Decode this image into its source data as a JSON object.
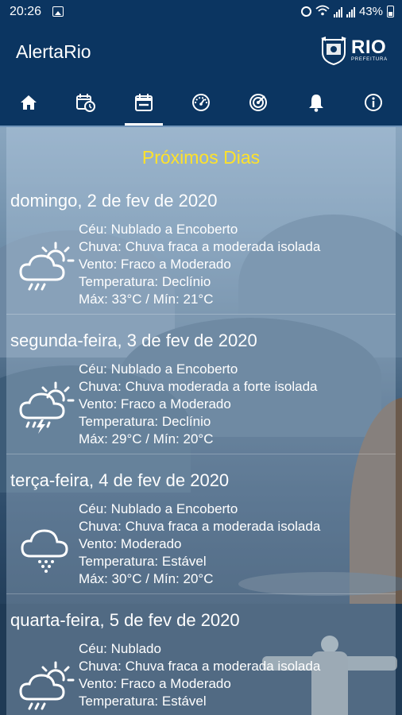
{
  "status_bar": {
    "time": "20:26",
    "battery": "43%"
  },
  "app_bar": {
    "title": "AlertaRio",
    "logo_text": "RIO",
    "logo_sub": "PREFEITURA"
  },
  "tabs": [
    {
      "name": "home-icon",
      "active": false
    },
    {
      "name": "calendar-clock-icon",
      "active": false
    },
    {
      "name": "calendar-icon",
      "active": true
    },
    {
      "name": "gauge-icon",
      "active": false
    },
    {
      "name": "radar-icon",
      "active": false
    },
    {
      "name": "bell-icon",
      "active": false
    },
    {
      "name": "info-icon",
      "active": false
    }
  ],
  "section_title": "Próximos Dias",
  "forecast": [
    {
      "date": "domingo, 2 de fev de 2020",
      "sky": "Céu: Nublado a Encoberto",
      "rain": "Chuva: Chuva fraca a moderada isolada",
      "wind": "Vento: Fraco a Moderado",
      "temp_trend": "Temperatura: Declínio",
      "minmax": "Máx: 33°C / Mín: 21°C",
      "icon": "sun-cloud-rain-icon"
    },
    {
      "date": "segunda-feira, 3 de fev de 2020",
      "sky": "Céu: Nublado a Encoberto",
      "rain": "Chuva: Chuva moderada a forte isolada",
      "wind": "Vento: Fraco a Moderado",
      "temp_trend": "Temperatura: Declínio",
      "minmax": "Máx: 29°C / Mín: 20°C",
      "icon": "sun-cloud-storm-icon"
    },
    {
      "date": "terça-feira, 4 de fev de 2020",
      "sky": "Céu: Nublado a Encoberto",
      "rain": "Chuva: Chuva fraca a moderada isolada",
      "wind": "Vento: Moderado",
      "temp_trend": "Temperatura: Estável",
      "minmax": "Máx: 30°C / Mín: 20°C",
      "icon": "cloud-rain-icon"
    },
    {
      "date": "quarta-feira, 5 de fev de 2020",
      "sky": "Céu: Nublado",
      "rain": "Chuva: Chuva fraca a moderada isolada",
      "wind": "Vento: Fraco a Moderado",
      "temp_trend": "Temperatura: Estável",
      "minmax": "",
      "icon": "sun-cloud-rain-icon"
    }
  ],
  "colors": {
    "header_bg": "#0b3561",
    "title_yellow": "#ffe22a",
    "text": "#ffffff"
  }
}
